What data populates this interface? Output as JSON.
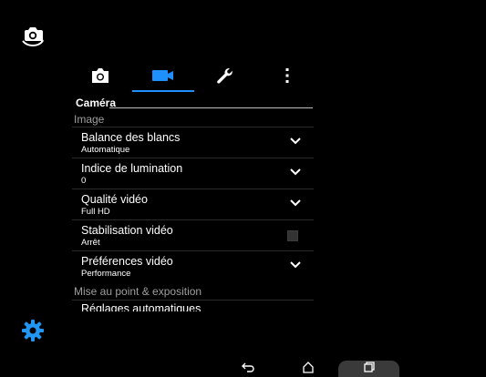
{
  "colors": {
    "accent": "#1e90ff",
    "background": "#000000",
    "text": "#ffffff",
    "subhead": "#9e9e9e",
    "gear": "#2196f3"
  },
  "left_icons": {
    "switch_camera": "switch-camera-icon",
    "settings": "gear-icon"
  },
  "tabs": [
    {
      "icon": "camera-icon",
      "selected": false
    },
    {
      "icon": "video-camera-icon",
      "selected": true
    },
    {
      "icon": "wrench-icon",
      "selected": false
    },
    {
      "icon": "more-vertical-icon",
      "selected": false
    }
  ],
  "section": {
    "title": "Caméra"
  },
  "groups": {
    "image": "Image",
    "focus": "Mise au point & exposition",
    "next_cut": "Réglages automatiques"
  },
  "rows": [
    {
      "title": "Balance des blancs",
      "value": "Automatique",
      "control": "dropdown"
    },
    {
      "title": "Indice de lumination",
      "value": "0",
      "control": "dropdown"
    },
    {
      "title": "Qualité vidéo",
      "value": "Full HD",
      "control": "dropdown"
    },
    {
      "title": "Stabilisation vidéo",
      "value": "Arrêt",
      "control": "checkbox",
      "checked": false
    },
    {
      "title": "Préférences vidéo",
      "value": "Performance",
      "control": "dropdown"
    }
  ],
  "navbar": {
    "back": "back-icon",
    "home": "home-icon",
    "recents": "recents-icon"
  }
}
